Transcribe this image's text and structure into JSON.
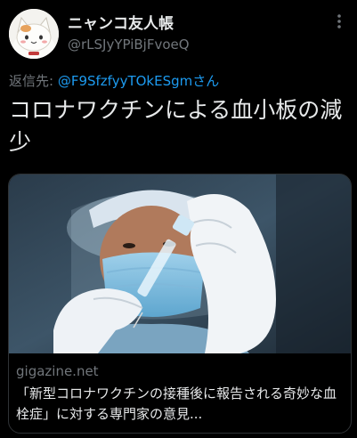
{
  "user": {
    "display_name": "ニャンコ友人帳",
    "handle": "@rLSJyYPiBjFvoeQ"
  },
  "reply": {
    "prefix": "返信先: ",
    "mention": "@F9SfzfyyTOkESgmさん"
  },
  "tweet": {
    "text": "コロナワクチンによる血小板の減少"
  },
  "card": {
    "domain": "gigazine.net",
    "title": "「新型コロナワクチンの接種後に報告される奇妙な血栓症」に対する専門家の意見..."
  },
  "icons": {
    "more": "more-icon",
    "avatar": "cat-avatar-icon"
  }
}
